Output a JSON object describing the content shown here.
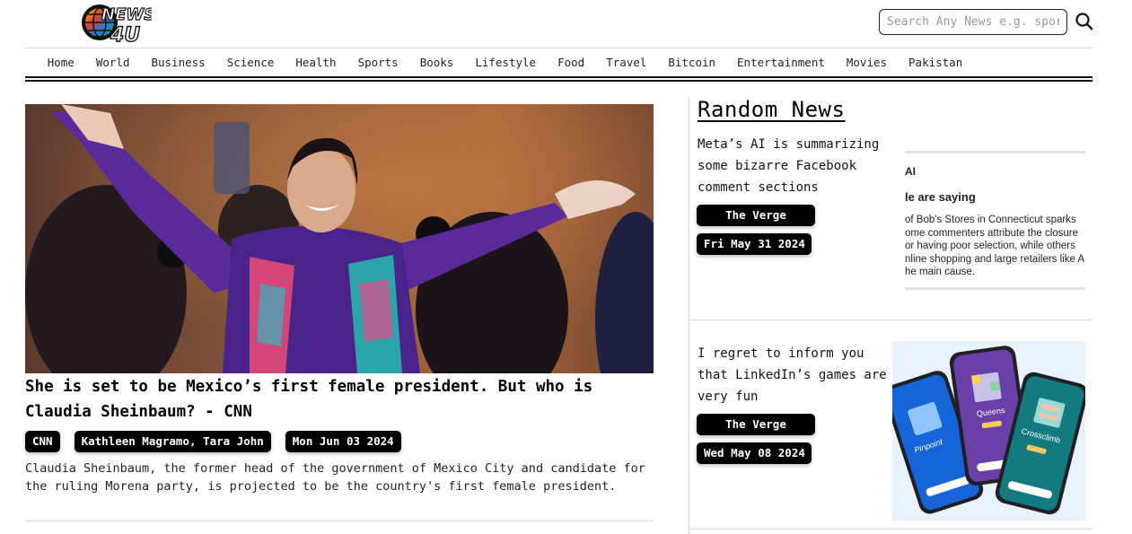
{
  "header": {
    "logo": {
      "line1": "NEWS",
      "line2": "4U"
    },
    "search": {
      "placeholder": "Search Any News e.g. sports",
      "value": ""
    }
  },
  "nav": {
    "items": [
      "Home",
      "World",
      "Business",
      "Science",
      "Health",
      "Sports",
      "Books",
      "Lifestyle",
      "Food",
      "Travel",
      "Bitcoin",
      "Entertainment",
      "Movies",
      "Pakistan"
    ]
  },
  "main_article": {
    "title": "She is set to be Mexico’s first female president. But who is Claudia Sheinbaum? - CNN",
    "source": "CNN",
    "authors": "Kathleen Magramo, Tara John",
    "date": "Mon Jun 03 2024",
    "description": "Claudia Sheinbaum, the former head of the government of Mexico City and candidate for the ruling Morena party, is projected to be the country's first female president.",
    "image_alt": "Claudia Sheinbaum waving to supporters"
  },
  "sidebar": {
    "title": "Random News",
    "items": [
      {
        "title": "Meta’s AI is summarizing some bizarre Facebook comment sections",
        "source": "The Verge",
        "date": "Fri May 31 2024",
        "thumb_text": {
          "label": "AI",
          "heading": "le are saying",
          "body": [
            "of Bob's Stores in Connecticut sparks",
            "ome commenters attribute the closure",
            "or having poor selection, while others",
            "nline shopping and large retailers like A",
            "he main cause."
          ]
        }
      },
      {
        "title": "I regret to inform you that LinkedIn’s games are very fun",
        "source": "The Verge",
        "date": "Wed May 08 2024",
        "thumb_text": {
          "phones": [
            "Pinpoint",
            "Queens",
            "Crossclimb"
          ]
        }
      }
    ]
  }
}
